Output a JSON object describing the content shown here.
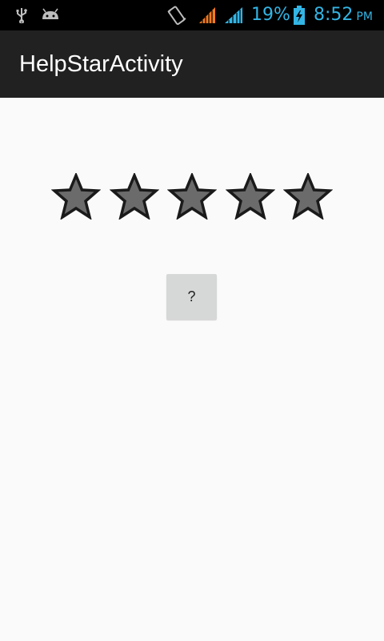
{
  "status_bar": {
    "battery_percent": "19%",
    "time": "8:52",
    "ampm": "PM",
    "accent_color": "#33b5e5",
    "icons": [
      "usb-icon",
      "android-debug-icon",
      "vibrate-icon",
      "signal-orange-icon",
      "signal-blue-icon",
      "battery-charging-icon"
    ]
  },
  "action_bar": {
    "title": "HelpStarActivity",
    "background": "#212121"
  },
  "rating": {
    "max_stars": 5,
    "value": 5,
    "star_color": "#6b6b6b"
  },
  "help_button": {
    "label": "?"
  }
}
